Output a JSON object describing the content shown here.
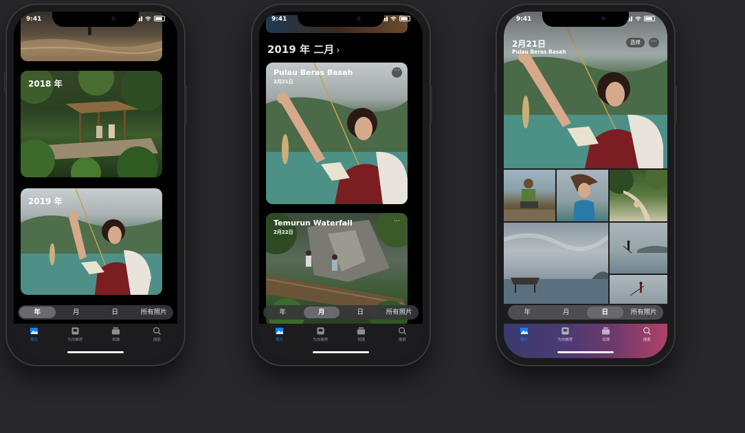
{
  "status": {
    "time": "9:41"
  },
  "segments": [
    "年",
    "月",
    "日",
    "所有照片"
  ],
  "tabs": [
    {
      "label": "照片",
      "icon": "photos-icon"
    },
    {
      "label": "为你推荐",
      "icon": "for-you-icon"
    },
    {
      "label": "相簿",
      "icon": "albums-icon"
    },
    {
      "label": "搜索",
      "icon": "search-icon"
    }
  ],
  "phone1": {
    "active_segment": 0,
    "years": [
      "2018 年",
      "2019 年"
    ]
  },
  "phone2": {
    "active_segment": 1,
    "header": "2019 年 二月",
    "cards": [
      {
        "title": "Pulau Beras Basah",
        "date": "2月21日"
      },
      {
        "title": "Temurun Waterfall",
        "date": "2月22日"
      }
    ]
  },
  "phone3": {
    "active_segment": 2,
    "date": "2月21日",
    "location": "Pulau Beras Basah",
    "select_label": "选择"
  },
  "colors": {
    "accent": "#0a84ff",
    "background": "#27272a"
  }
}
